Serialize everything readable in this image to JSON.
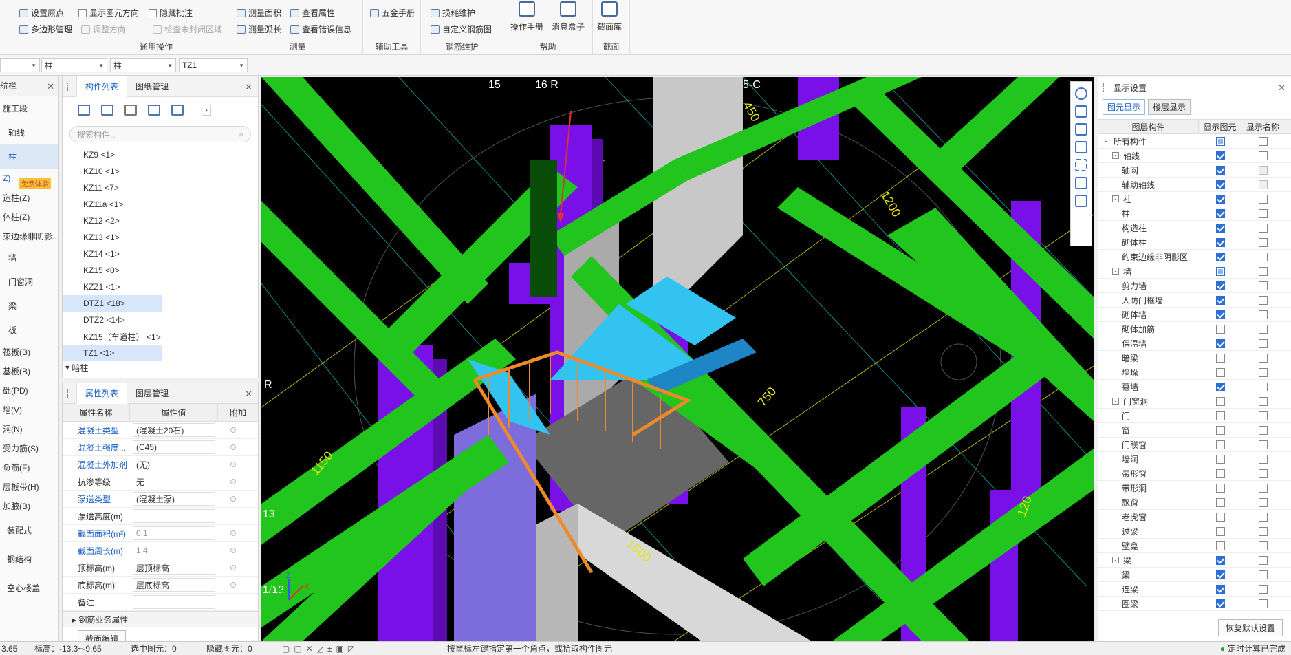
{
  "ribbon": {
    "groups": [
      {
        "label": "通用操作",
        "items": [
          "设置原点",
          "多边形管理",
          "显示图元方向",
          "调整方向",
          "隐藏批注",
          "检查未封闭区域"
        ]
      },
      {
        "label": "测量",
        "items": [
          "测量面积",
          "测量弧长",
          "查看属性",
          "查看错误信息"
        ]
      },
      {
        "label": "辅助工具",
        "items": [
          "五金手册"
        ]
      },
      {
        "label": "钢筋维护",
        "items": [
          "损耗维护",
          "自定义钢筋图"
        ]
      },
      {
        "label": "帮助",
        "items": [
          "操作手册",
          "消息盒子"
        ]
      },
      {
        "label": "截面",
        "items": [
          "截面库"
        ]
      }
    ]
  },
  "selectors": {
    "floor": "",
    "type1": "柱",
    "type2": "柱",
    "component": "TZ1"
  },
  "nav": {
    "title": "航栏",
    "badge": "免费体验",
    "items": [
      "施工段",
      "轴线",
      "柱",
      "Z)",
      "造柱(Z)",
      "体柱(Z)",
      "束边缘非阴影...",
      "墙",
      "门窗洞",
      "梁",
      "板",
      "筏板(B)",
      "基板(B)",
      "础(PD)",
      "墙(V)",
      "洞(N)",
      "受力筋(S)",
      "负筋(F)",
      "层板带(H)",
      "加腋(B)",
      "装配式",
      "钢结构",
      "空心楼盖"
    ]
  },
  "complist": {
    "tabs": [
      "构件列表",
      "图纸管理"
    ],
    "search_placeholder": "搜索构件...",
    "items": [
      "KZ9 <1>",
      "KZ10 <1>",
      "KZ11 <7>",
      "KZ11a <1>",
      "KZ12 <2>",
      "KZ13 <1>",
      "KZ14 <1>",
      "KZ15 <0>",
      "KZZ1 <1>",
      "DTZ1 <18>",
      "DTZ2 <14>",
      "KZ15（车道柱） <1>",
      "TZ1 <1>"
    ],
    "group": "暗柱"
  },
  "props": {
    "tabs": [
      "属性列表",
      "图层管理"
    ],
    "headers": [
      "属性名称",
      "属性值",
      "附加"
    ],
    "rows": [
      {
        "name": "混凝土类型",
        "value": "(混凝土20石)"
      },
      {
        "name": "混凝土强度...",
        "value": "(C45)"
      },
      {
        "name": "混凝土外加剂",
        "value": "(无)"
      },
      {
        "name": "抗渗等级",
        "value": "无"
      },
      {
        "name": "泵送类型",
        "value": "(混凝土泵)"
      },
      {
        "name": "泵送高度(m)",
        "value": ""
      },
      {
        "name": "截面面积(m²)",
        "value": "0.1"
      },
      {
        "name": "截面周长(m)",
        "value": "1.4"
      },
      {
        "name": "顶标高(m)",
        "value": "层顶标高"
      },
      {
        "name": "底标高(m)",
        "value": "层底标高"
      },
      {
        "name": "备注",
        "value": ""
      }
    ],
    "footer": "钢筋业务属性",
    "button": "截面编辑"
  },
  "viewport": {
    "labels": [
      "15",
      "16 R",
      "5-C",
      "R",
      "13",
      "1/12",
      "750",
      "1150",
      "1500",
      "450",
      "1200",
      "120"
    ],
    "axis": [
      "X",
      "Y",
      "Z"
    ]
  },
  "display": {
    "title": "显示设置",
    "tabs": [
      "图元显示",
      "楼层显示"
    ],
    "headers": [
      "图层构件",
      "显示图元",
      "显示名称"
    ],
    "rows": [
      {
        "name": "所有构件",
        "level": 0,
        "exp": "-",
        "show": "part",
        "label": "off"
      },
      {
        "name": "轴线",
        "level": 1,
        "exp": "-",
        "show": "on",
        "label": "off"
      },
      {
        "name": "轴网",
        "level": 2,
        "show": "on",
        "label": "dim"
      },
      {
        "name": "辅助轴线",
        "level": 2,
        "show": "on",
        "label": "dim"
      },
      {
        "name": "柱",
        "level": 1,
        "exp": "-",
        "show": "on",
        "label": "off"
      },
      {
        "name": "柱",
        "level": 2,
        "show": "on",
        "label": "off"
      },
      {
        "name": "构造柱",
        "level": 2,
        "show": "on",
        "label": "off"
      },
      {
        "name": "砌体柱",
        "level": 2,
        "show": "on",
        "label": "off"
      },
      {
        "name": "约束边缘非阴影区",
        "level": 2,
        "show": "on",
        "label": "off"
      },
      {
        "name": "墙",
        "level": 1,
        "exp": "-",
        "show": "part",
        "label": "off"
      },
      {
        "name": "剪力墙",
        "level": 2,
        "show": "on",
        "label": "off"
      },
      {
        "name": "人防门框墙",
        "level": 2,
        "show": "on",
        "label": "off"
      },
      {
        "name": "砌体墙",
        "level": 2,
        "show": "on",
        "label": "off"
      },
      {
        "name": "砌体加筋",
        "level": 2,
        "show": "off",
        "label": "off"
      },
      {
        "name": "保温墙",
        "level": 2,
        "show": "on",
        "label": "off"
      },
      {
        "name": "暗梁",
        "level": 2,
        "show": "off",
        "label": "off"
      },
      {
        "name": "墙垛",
        "level": 2,
        "show": "off",
        "label": "off"
      },
      {
        "name": "幕墙",
        "level": 2,
        "show": "on",
        "label": "off"
      },
      {
        "name": "门窗洞",
        "level": 1,
        "exp": "-",
        "show": "off",
        "label": "off"
      },
      {
        "name": "门",
        "level": 2,
        "show": "off",
        "label": "off"
      },
      {
        "name": "窗",
        "level": 2,
        "show": "off",
        "label": "off"
      },
      {
        "name": "门联窗",
        "level": 2,
        "show": "off",
        "label": "off"
      },
      {
        "name": "墙洞",
        "level": 2,
        "show": "off",
        "label": "off"
      },
      {
        "name": "带形窗",
        "level": 2,
        "show": "off",
        "label": "off"
      },
      {
        "name": "带形洞",
        "level": 2,
        "show": "off",
        "label": "off"
      },
      {
        "name": "飘窗",
        "level": 2,
        "show": "off",
        "label": "off"
      },
      {
        "name": "老虎窗",
        "level": 2,
        "show": "off",
        "label": "off"
      },
      {
        "name": "过梁",
        "level": 2,
        "show": "off",
        "label": "off"
      },
      {
        "name": "壁龛",
        "level": 2,
        "show": "off",
        "label": "off"
      },
      {
        "name": "梁",
        "level": 1,
        "exp": "-",
        "show": "on",
        "label": "off"
      },
      {
        "name": "梁",
        "level": 2,
        "show": "on",
        "label": "off"
      },
      {
        "name": "连梁",
        "level": 2,
        "show": "on",
        "label": "off"
      },
      {
        "name": "圈梁",
        "level": 2,
        "show": "on",
        "label": "off"
      }
    ],
    "reset_button": "恢复默认设置"
  },
  "status": {
    "coord": "3.65",
    "elevation": "标高：-13.3~-9.65",
    "selected": "选中图元：0",
    "hidden": "隐藏图元：0",
    "hint": "按鼠标左键指定第一个角点，或拾取构件图元",
    "autosave": "定时计算已完成"
  },
  "colors": {
    "green": "#22c41e",
    "purple": "#7a10e8",
    "blue": "#33c3f0",
    "orange": "#ef8a2a",
    "accent": "#1a5fc4"
  }
}
